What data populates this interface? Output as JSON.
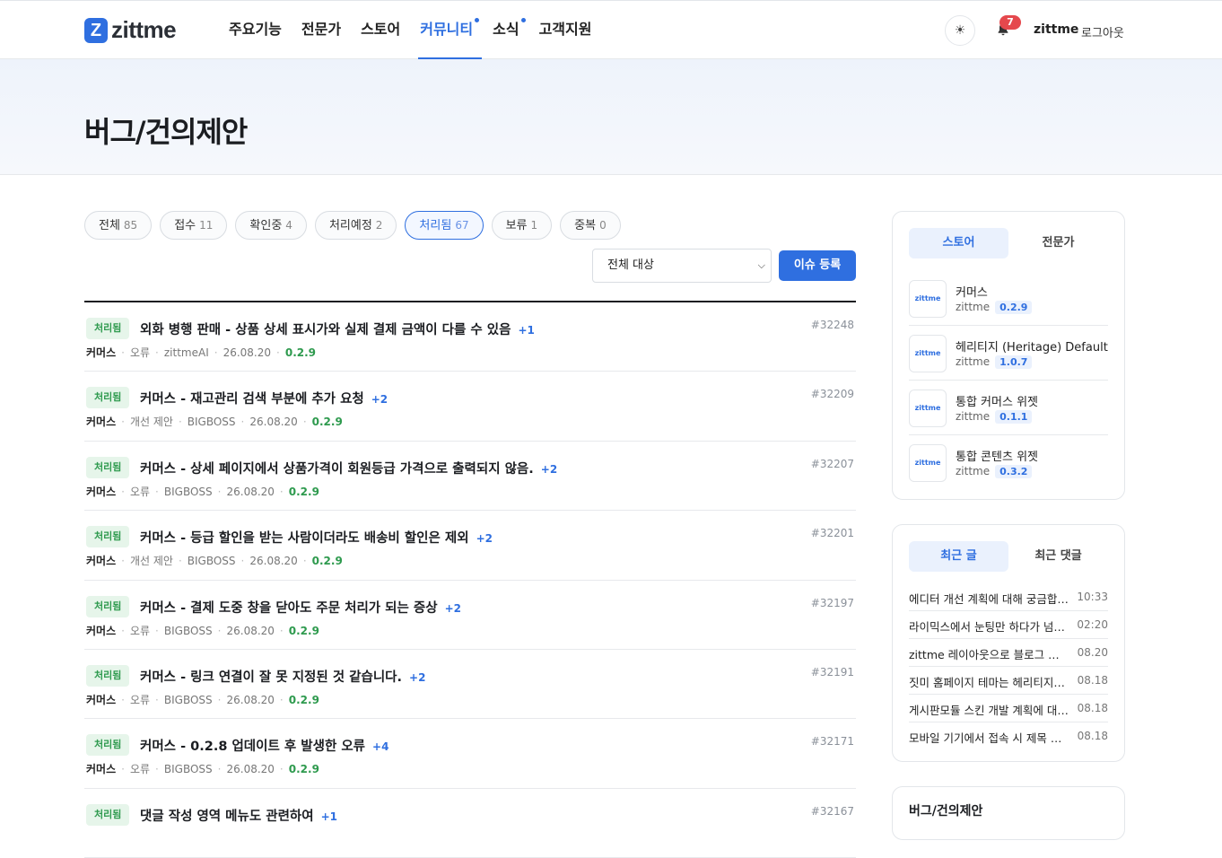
{
  "header": {
    "logo_mark": "Z",
    "logo_text": "zittme",
    "nav": [
      {
        "label": "주요기능"
      },
      {
        "label": "전문가"
      },
      {
        "label": "스토어"
      },
      {
        "label": "커뮤니티"
      },
      {
        "label": "소식"
      },
      {
        "label": "고객지원"
      }
    ],
    "theme_icon": "☀",
    "bell_icon": "🔔",
    "notifications": "7",
    "user": "zittme",
    "logout": "로그아웃"
  },
  "hero": {
    "title": "버그/건의제안"
  },
  "filters": [
    {
      "label": "전체",
      "count": "85"
    },
    {
      "label": "접수",
      "count": "11"
    },
    {
      "label": "확인중",
      "count": "4"
    },
    {
      "label": "처리예정",
      "count": "2"
    },
    {
      "label": "처리됨",
      "count": "67"
    },
    {
      "label": "보류",
      "count": "1"
    },
    {
      "label": "중복",
      "count": "0"
    }
  ],
  "select": {
    "value": "전체 대상"
  },
  "register_button": "이슈 등록",
  "issues": [
    {
      "status": "처리됨",
      "title": "외화 병행 판매 - 상품 상세 표시가와 실제 결제 금액이 다를 수 있음",
      "plus": "+1",
      "number": "#32248",
      "category": "커머스",
      "type": "오류",
      "author": "zittmeAI",
      "date": "26.08.20",
      "version": "0.2.9"
    },
    {
      "status": "처리됨",
      "title": "커머스 - 재고관리 검색 부분에 추가 요청",
      "plus": "+2",
      "number": "#32209",
      "category": "커머스",
      "type": "개선 제안",
      "author": "BIGBOSS",
      "date": "26.08.20",
      "version": "0.2.9"
    },
    {
      "status": "처리됨",
      "title": "커머스 - 상세 페이지에서 상품가격이 회원등급 가격으로 출력되지 않음.",
      "plus": "+2",
      "number": "#32207",
      "category": "커머스",
      "type": "오류",
      "author": "BIGBOSS",
      "date": "26.08.20",
      "version": "0.2.9"
    },
    {
      "status": "처리됨",
      "title": "커머스 - 등급 할인을 받는 사람이더라도 배송비 할인은 제외",
      "plus": "+2",
      "number": "#32201",
      "category": "커머스",
      "type": "개선 제안",
      "author": "BIGBOSS",
      "date": "26.08.20",
      "version": "0.2.9"
    },
    {
      "status": "처리됨",
      "title": "커머스 - 결제 도중 창을 닫아도 주문 처리가 되는 증상",
      "plus": "+2",
      "number": "#32197",
      "category": "커머스",
      "type": "오류",
      "author": "BIGBOSS",
      "date": "26.08.20",
      "version": "0.2.9"
    },
    {
      "status": "처리됨",
      "title": "커머스 - 링크 연결이 잘 못 지정된 것 같습니다.",
      "plus": "+2",
      "number": "#32191",
      "category": "커머스",
      "type": "오류",
      "author": "BIGBOSS",
      "date": "26.08.20",
      "version": "0.2.9"
    },
    {
      "status": "처리됨",
      "title": "커머스 - 0.2.8 업데이트 후 발생한 오류",
      "plus": "+4",
      "number": "#32171",
      "category": "커머스",
      "type": "오류",
      "author": "BIGBOSS",
      "date": "26.08.20",
      "version": "0.2.9"
    },
    {
      "status": "처리됨",
      "title": "댓글 작성 영역 메뉴도 관련하여",
      "plus": "+1",
      "number": "#32167",
      "category": "",
      "type": "",
      "author": "",
      "date": "",
      "version": ""
    }
  ],
  "store_card": {
    "tabs": [
      "스토어",
      "전문가"
    ],
    "products": [
      {
        "thumb": "zittme",
        "name": "커머스",
        "vendor": "zittme",
        "version": "0.2.9"
      },
      {
        "thumb": "zittme",
        "name": "헤리티지 (Heritage) Default",
        "vendor": "zittme",
        "version": "1.0.7"
      },
      {
        "thumb": "zittme",
        "name": "통합 커머스 위젯",
        "vendor": "zittme",
        "version": "0.1.1"
      },
      {
        "thumb": "zittme",
        "name": "통합 콘텐츠 위젯",
        "vendor": "zittme",
        "version": "0.3.2"
      }
    ]
  },
  "recent_card": {
    "tabs": [
      "최근 글",
      "최근 댓글"
    ],
    "posts": [
      {
        "title": "에디터 개선 계획에 대해 궁금합니다",
        "time": "10:33"
      },
      {
        "title": "라이믹스에서 눈팅만 하다가 넘어왔어요",
        "time": "02:20"
      },
      {
        "title": "zittme 레이아웃으로 블로그 적용기",
        "time": "08.20"
      },
      {
        "title": "짓미 홈페이지 테마는 헤리티지와 다른가요",
        "time": "08.18"
      },
      {
        "title": "게시판모듈 스킨 개발 계획에 대해 문의",
        "time": "08.18"
      },
      {
        "title": "모바일 기기에서 접속 시 제목 글자 깨짐",
        "time": "08.18"
      }
    ]
  },
  "bottom_card": {
    "title": "버그/건의제안"
  }
}
